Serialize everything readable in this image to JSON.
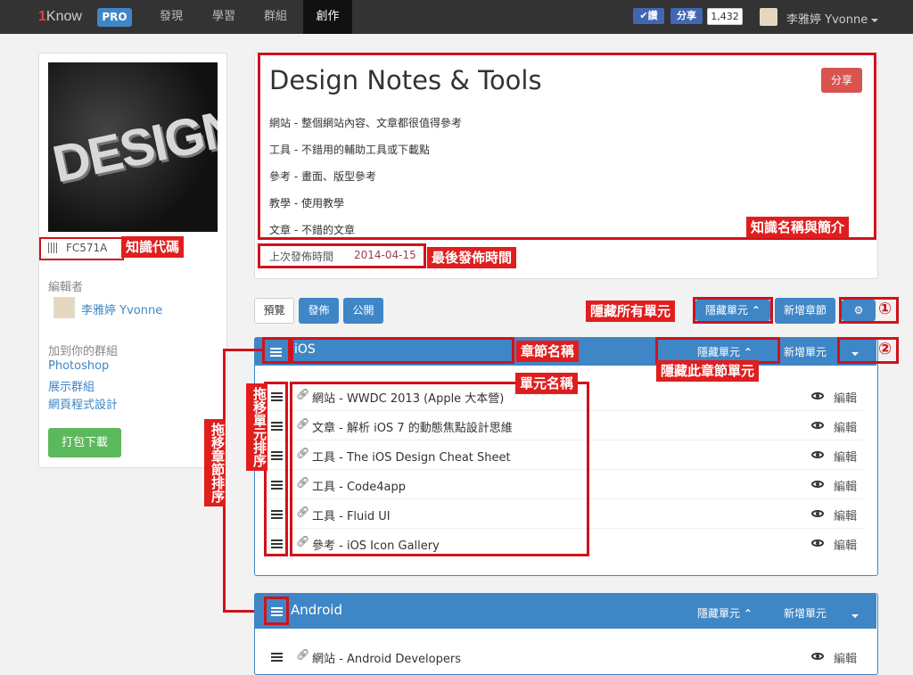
{
  "nav": {
    "brand_one": "1",
    "brand_rest": "Know",
    "pro": "PRO",
    "items": [
      "發現",
      "學習",
      "群組",
      "創作"
    ],
    "like": "讚",
    "share": "分享",
    "share_count": "1,432",
    "user": "李雅婷 Yvonne"
  },
  "sidebar": {
    "cover_text": "DESIGN",
    "code": "FC571A",
    "editor_heading": "編輯者",
    "editor_name": "李雅婷 Yvonne",
    "groups_heading": "加到你的群組",
    "groups": [
      "Photoshop",
      "展示群組",
      "網頁程式設計"
    ],
    "download_button": "打包下載"
  },
  "knowledge": {
    "title": "Design Notes & Tools",
    "share_button": "分享",
    "desc_lines": [
      "網站 - 整個網站內容、文章都很值得參考",
      "工具 - 不錯用的輔助工具或下載點",
      "參考 - 畫面、版型參考",
      "教學 - 使用教學",
      "文章 - 不錯的文章"
    ],
    "last_publish_label": "上次發佈時間",
    "last_publish_date": "2014-04-15"
  },
  "toolbar": {
    "preview": "預覽",
    "publish": "發佈",
    "public": "公開",
    "hide_units": "隱藏單元",
    "add_chapter": "新增章節"
  },
  "sections": [
    {
      "name": "iOS",
      "hide_units": "隱藏單元",
      "add_unit": "新增單元",
      "units": [
        "網站 - WWDC 2013 (Apple 大本營)",
        "文章 - 解析 iOS 7 的動態焦點設計思維",
        "工具 - The iOS Design Cheat Sheet",
        "工具 - Code4app",
        "工具 - Fluid UI",
        "參考 - iOS Icon Gallery"
      ]
    },
    {
      "name": "Android",
      "hide_units": "隱藏單元",
      "add_unit": "新增單元",
      "units": [
        "網站 - Android Developers"
      ]
    }
  ],
  "unit_edit_label": "編輯",
  "annotations": {
    "code": "知識代碼",
    "name_intro": "知識名稱與簡介",
    "last_publish": "最後發佈時間",
    "hide_all": "隱藏所有單元",
    "chapter_name": "章節名稱",
    "hide_chapter": "隱藏此章節單元",
    "unit_name": "單元名稱",
    "drag_units": "拖移單元排序",
    "drag_chapters": "拖移章節排序",
    "num1": "①",
    "num2": "②"
  },
  "colors": {
    "accent": "#3f86c6",
    "annotation_red": "#d0121b",
    "success": "#5cb85c",
    "navbar": "#333333"
  }
}
